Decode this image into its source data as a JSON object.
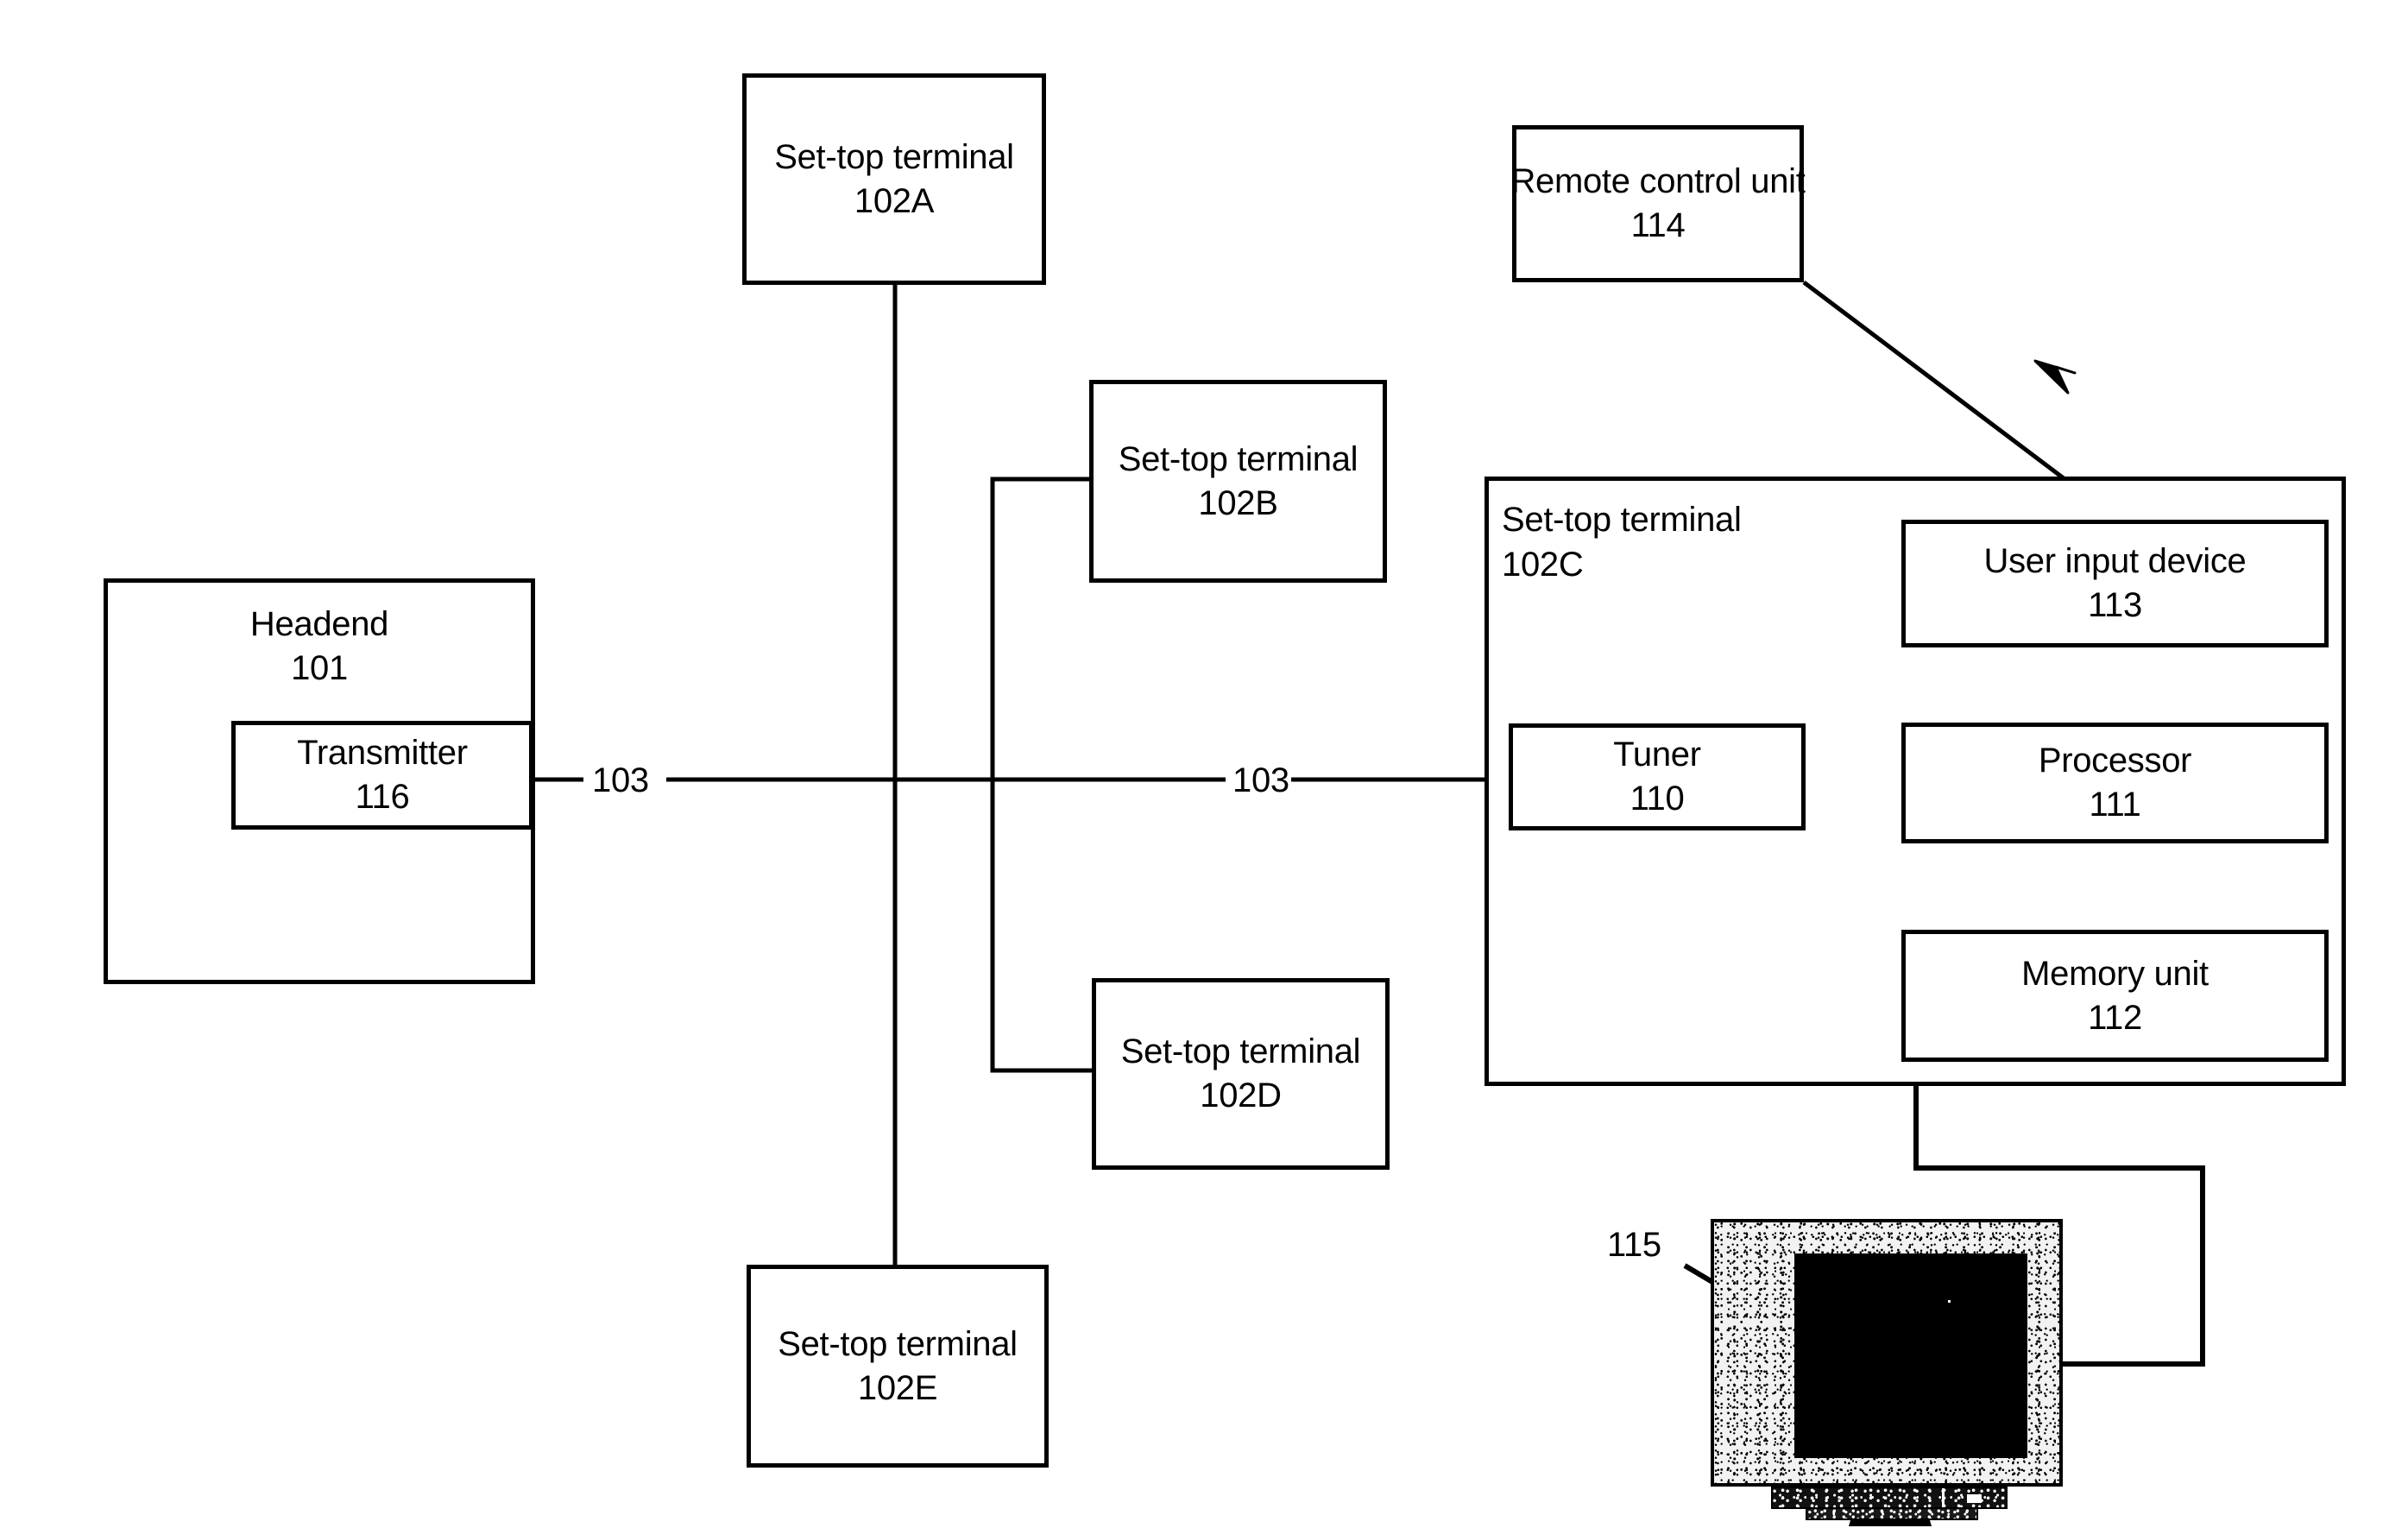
{
  "figure": {
    "type": "patent-block-diagram",
    "nodes": {
      "headend": {
        "title": "Headend",
        "ref": "101"
      },
      "transmitter": {
        "title": "Transmitter",
        "ref": "116"
      },
      "stt_a": {
        "title": "Set-top terminal",
        "ref": "102A"
      },
      "stt_b": {
        "title": "Set-top terminal",
        "ref": "102B"
      },
      "stt_c": {
        "title": "Set-top terminal",
        "ref": "102C"
      },
      "stt_d": {
        "title": "Set-top terminal",
        "ref": "102D"
      },
      "stt_e": {
        "title": "Set-top terminal",
        "ref": "102E"
      },
      "remote": {
        "title": "Remote control unit",
        "ref": "114"
      },
      "user_input": {
        "title": "User input device",
        "ref": "113"
      },
      "processor": {
        "title": "Processor",
        "ref": "111"
      },
      "memory": {
        "title": "Memory unit",
        "ref": "112"
      },
      "tuner": {
        "title": "Tuner",
        "ref": "110"
      },
      "display": {
        "ref": "115"
      }
    },
    "connection_labels": {
      "network_left": "103",
      "network_right": "103"
    },
    "colors": {
      "line": "#000000",
      "background": "#ffffff",
      "screen": "#000000"
    }
  }
}
